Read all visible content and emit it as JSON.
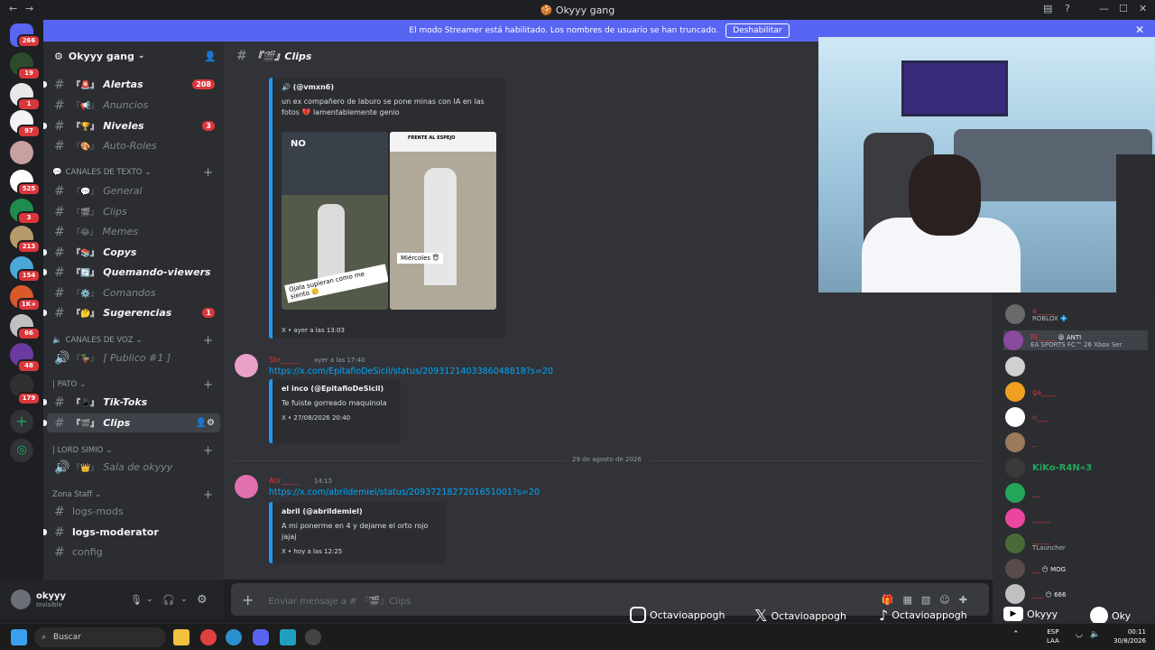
{
  "window": {
    "title": "Okyyy gang"
  },
  "banner": {
    "text": "El modo Streamer está habilitado. Los nombres de usuario se han truncado.",
    "button": "Deshabilitar"
  },
  "server_badges": [
    "266",
    "19",
    "1",
    "97",
    "525",
    "3",
    "213",
    "154",
    "1K+",
    "66",
    "48",
    "179"
  ],
  "server": {
    "name": "Okyyy gang"
  },
  "channels_top": [
    {
      "emoji": "『🚨』",
      "name": "Alertas",
      "unread": true,
      "badge": "208"
    },
    {
      "emoji": "『📢』",
      "name": "Anuncios",
      "unread": false,
      "badge": ""
    },
    {
      "emoji": "『🏆』",
      "name": "Niveles",
      "unread": true,
      "badge": "3"
    },
    {
      "emoji": "『🎨』",
      "name": "Auto-Roles",
      "unread": false,
      "badge": ""
    }
  ],
  "categories": {
    "text": "CANALES DE TEXTO",
    "voice": "CANALES DE VOZ",
    "pato": "| PATO",
    "lord": "| LORD SIMIO",
    "staff": "Zona Staff"
  },
  "channels_text": [
    {
      "emoji": "『💬』",
      "name": "General",
      "unread": false,
      "badge": ""
    },
    {
      "emoji": "『🎬』",
      "name": "Clips",
      "unread": false,
      "badge": ""
    },
    {
      "emoji": "『😂』",
      "name": "Memes",
      "unread": false,
      "badge": ""
    },
    {
      "emoji": "『📚』",
      "name": "Copys",
      "unread": true,
      "badge": ""
    },
    {
      "emoji": "『🔄』",
      "name": "Quemando-viewers",
      "unread": true,
      "badge": ""
    },
    {
      "emoji": "『⚙️』",
      "name": "Comandos",
      "unread": false,
      "badge": ""
    },
    {
      "emoji": "『🤔』",
      "name": "Sugerencias",
      "unread": true,
      "badge": "1"
    }
  ],
  "channels_voice": [
    {
      "emoji": "『🦆』",
      "name": "[ Publico #1 ]"
    }
  ],
  "channels_pato": [
    {
      "emoji": "『📱』",
      "name": "Tik-Toks",
      "unread": true
    },
    {
      "emoji": "『🎬』",
      "name": "Clips",
      "active": true
    }
  ],
  "channels_lord": [
    {
      "emoji": "『👑』",
      "name": "Sala de okyyy"
    }
  ],
  "channels_staff": [
    {
      "name": "logs-mods",
      "unread": false
    },
    {
      "name": "logs-moderator",
      "unread": true
    },
    {
      "name": "config",
      "unread": false
    }
  ],
  "user": {
    "name": "okyyy",
    "status": "Invisible"
  },
  "chat": {
    "channel": "『🎬』Clips",
    "embed1": {
      "author": "🔊 (@vmxn6)",
      "text": "un ex compañero de laburo se pone minas con IA en las fotos 💔 lamentablemente genio",
      "img1_caption_top": "NO",
      "img1_caption": "Ojala supieran como me siento 🥲",
      "img2_header": "FRENTE AL ESPEJO",
      "img2_caption": "Miércoles 😇",
      "footer": "X • ayer a las 13:03"
    },
    "msg2": {
      "time": "ayer a las 17:40",
      "link": "https://x.com/EpitafioDeSicil/status/2093121403386048818?s=20",
      "embed": {
        "author": "el inco (@EpitafioDeSicil)",
        "text": "Te fuiste gorreado maquinola",
        "footer": "X • 27/08/2026 20:40"
      }
    },
    "divider": "29 de agosto de 2026",
    "msg3": {
      "time": "14:15",
      "link": "https://x.com/abrildemiel/status/2093721827201651001?s=20",
      "embed": {
        "author": "abril (@abrildemiel)",
        "text": "A mi ponerme en 4 y dejame el orto rojo jajaj",
        "footer": "X • hoy a las 12:25"
      }
    },
    "placeholder": "Enviar mensaje a # 『🎬』Clips"
  },
  "members": [
    {
      "name": "a_____",
      "status": "ROBLOX 💠",
      "color": "#da373c"
    },
    {
      "name": "Ri_____",
      "status": "EA SPORTS FC™ 26 Xbox Ser",
      "tag": "😝 ANTI",
      "color": "#da373c"
    },
    {
      "name": "",
      "status": "",
      "color": "#da373c"
    },
    {
      "name": "ga____",
      "status": "",
      "color": "#da373c"
    },
    {
      "name": "n___",
      "status": "",
      "color": "#da373c"
    },
    {
      "name": "_",
      "status": "",
      "color": "#da373c"
    },
    {
      "name": "KiKo-R4N«3",
      "status": "",
      "color": "#23a55a"
    },
    {
      "name": "__",
      "status": "",
      "color": "#da373c"
    },
    {
      "name": "_____",
      "status": "",
      "color": "#da373c"
    },
    {
      "name": "_____",
      "status": "TLauncher",
      "color": "#da373c"
    },
    {
      "name": "__",
      "tag": "😶 MOG",
      "status": "",
      "color": "#da373c"
    },
    {
      "name": "___",
      "tag": "😶 666",
      "status": "",
      "color": "#da373c"
    }
  ],
  "socials": [
    {
      "icon": "instagram-icon",
      "handle": "Octavioappogh"
    },
    {
      "icon": "x-icon",
      "handle": "Octavioappogh"
    },
    {
      "icon": "tiktok-icon",
      "handle": "Octavioappogh"
    },
    {
      "icon": "youtube-icon",
      "handle": "Okyyy"
    },
    {
      "icon": "spotify-icon",
      "handle": "Oky"
    }
  ],
  "taskbar": {
    "search": "Buscar",
    "lang": "ESP",
    "lang2": "LAA",
    "time": "00:11",
    "date": "30/8/2026"
  }
}
